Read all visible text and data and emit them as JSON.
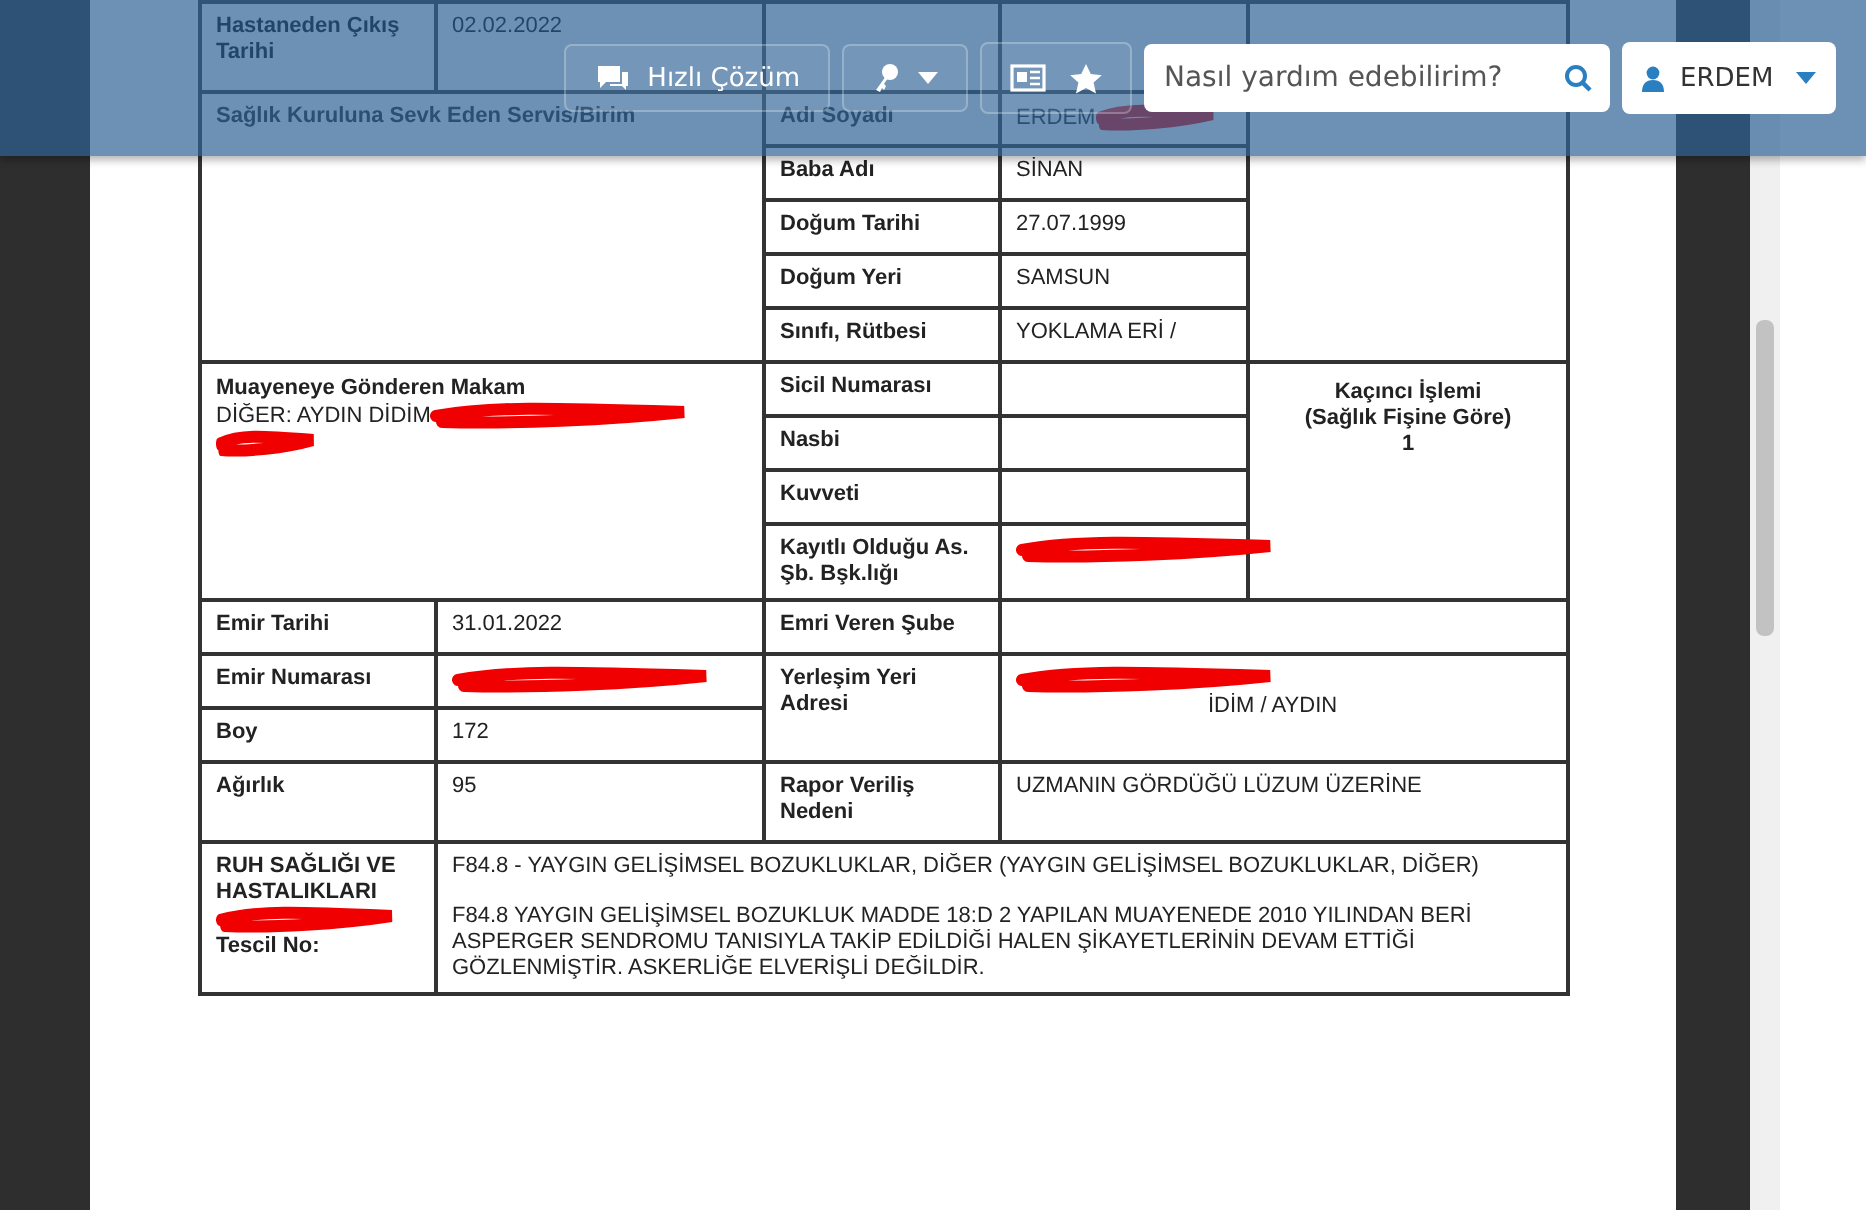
{
  "header": {
    "quick_button": "Hızlı Çözüm",
    "search": {
      "placeholder": "Nasıl yardım edebilirim?"
    },
    "user": "ERDEM"
  },
  "report": {
    "discharge": {
      "label": "Hastaneden Çıkış Tarihi",
      "value": "02.02.2022"
    },
    "referring_unit": {
      "label": "Sağlık Kuruluna Sevk Eden Servis/Birim"
    },
    "identity": [
      {
        "label": "Adı Soyadı",
        "value": "ERDEM",
        "redacted": true
      },
      {
        "label": "Baba Adı",
        "value": "SİNAN",
        "redacted": false
      },
      {
        "label": "Doğum Tarihi",
        "value": "27.07.1999",
        "redacted": false
      },
      {
        "label": "Doğum Yeri",
        "value": "SAMSUN",
        "redacted": false
      },
      {
        "label": "Sınıfı, Rütbesi",
        "value": "YOKLAMA ERİ /",
        "redacted": false
      }
    ],
    "sender": {
      "label": "Muayeneye Gönderen Makam",
      "value": "DİĞER: AYDIN DİDİM",
      "redacted": true
    },
    "service": [
      {
        "label": "Sicil Numarası",
        "redacted": false
      },
      {
        "label": "Nasbi",
        "redacted": false
      },
      {
        "label": "Kuvveti",
        "redacted": false
      },
      {
        "label": "Kayıtlı Olduğu As. Şb. Bşk.lığı",
        "redacted": true
      }
    ],
    "order_count": {
      "label_lines": [
        "Kaçıncı İşlemi",
        "(Sağlık Fişine Göre)"
      ],
      "value": "1"
    },
    "order_date": {
      "label": "Emir Tarihi",
      "value": "31.01.2022"
    },
    "issuing_branch": {
      "label": "Emri Veren Şube"
    },
    "order_number": {
      "label": "Emir Numarası",
      "redacted": true
    },
    "address": {
      "label": "Yerleşim Yeri Adresi",
      "value": "İDİM / AYDIN",
      "redacted": true
    },
    "height": {
      "label": "Boy",
      "value": "172"
    },
    "weight": {
      "label": "Ağırlık",
      "value": "95"
    },
    "reason": {
      "label": "Rapor Veriliş Nedeni",
      "value": "UZMANIN GÖRDÜĞÜ LÜZUM ÜZERİNE"
    },
    "department": {
      "label": "RUH SAĞLIĞI VE HASTALIKLARI",
      "registry_label": "Tescil No:",
      "redacted": true
    },
    "diagnosis": "F84.8 - YAYGIN GELİŞİMSEL BOZUKLUKLAR, DİĞER (YAYGIN GELİŞİMSEL BOZUKLUKLAR, DİĞER)",
    "decision": "F84.8 YAYGIN GELİŞİMSEL BOZUKLUK MADDE 18:D 2 YAPILAN MUAYENEDE 2010 YILINDAN BERİ ASPERGER SENDROMU TANISIYLA TAKİP EDİLDİĞİ HALEN ŞİKAYETLERİNİN DEVAM ETTİĞİ GÖZLENMİŞTİR. ASKERLİĞE ELVERİŞLİ DEĞİLDİR."
  }
}
